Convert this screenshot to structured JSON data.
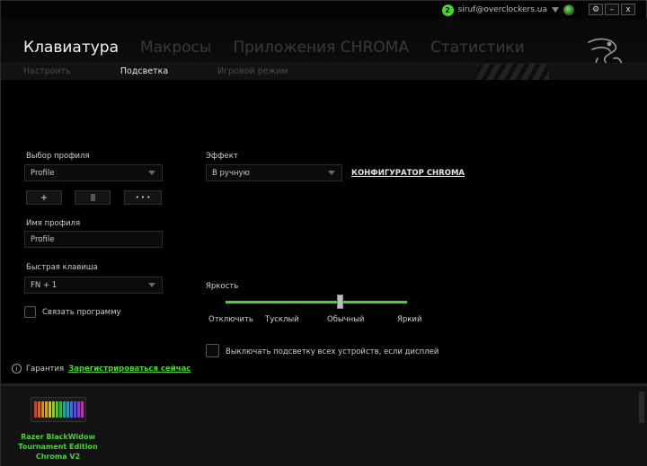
{
  "titlebar": {
    "notifications": "2",
    "account": "siruf@overclockers.ua",
    "buttons": {
      "settings": "⚙",
      "minimize": "–",
      "close": "x"
    }
  },
  "main_tabs": [
    "Клавиатура",
    "Макросы",
    "Приложения CHROMA",
    "Статистики"
  ],
  "sub_tabs": [
    "Настроить",
    "Подсветка",
    "Игровой режим"
  ],
  "profile": {
    "select_label": "Выбор профиля",
    "selected": "Profile",
    "add_button": "+",
    "more_button": "• • •",
    "name_label": "Имя профиля",
    "name_value": "Profile",
    "hotkey_label": "Быстрая клавиша",
    "hotkey_value": "FN + 1",
    "link_program": "Связать программу"
  },
  "effect": {
    "label": "Эффект",
    "selected": "В ручную",
    "chroma_link": "КОНФИГУРАТОР CHROMA"
  },
  "brightness": {
    "label": "Яркость",
    "stops": [
      "Отключить",
      "Тусклый",
      "Обычный",
      "Яркий"
    ],
    "value": "Обычный",
    "level": 0.63
  },
  "display_off_option": "Выключать подсветку всех устройств, если дисплей",
  "warranty": {
    "label": "Гарантия",
    "register_link": "Зарегистрироваться сейчас"
  },
  "device": {
    "name_lines": [
      "Razer BlackWidow",
      "Tournament Edition",
      "Chroma V2"
    ]
  },
  "colors": {
    "accent": "#44d62c",
    "background": "#000000",
    "panel": "#121212"
  }
}
